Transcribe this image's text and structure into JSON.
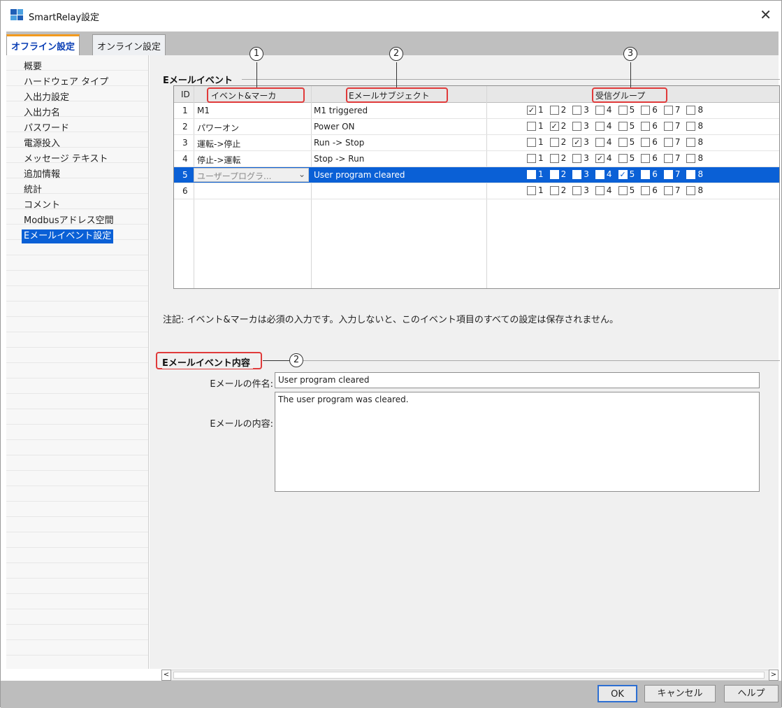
{
  "window": {
    "title": "SmartRelay設定",
    "close_glyph": "✕"
  },
  "tabs": [
    {
      "label": "オフライン設定"
    },
    {
      "label": "オンライン設定"
    }
  ],
  "sidebar": {
    "items": [
      {
        "label": "概要"
      },
      {
        "label": "ハードウェア タイプ"
      },
      {
        "label": "入出力設定"
      },
      {
        "label": "入出力名"
      },
      {
        "label": "パスワード"
      },
      {
        "label": "電源投入"
      },
      {
        "label": "メッセージ テキスト"
      },
      {
        "label": "追加情報"
      },
      {
        "label": "統計"
      },
      {
        "label": "コメント"
      },
      {
        "label": "Modbusアドレス空間"
      },
      {
        "label": "Eメールイベント設定"
      }
    ]
  },
  "email_events": {
    "section_title": "Eメールイベント",
    "columns": {
      "id": "ID",
      "event": "イベント&マーカ",
      "subject": "Eメールサブジェクト",
      "groups": "受信グループ"
    },
    "rows": [
      {
        "id": "1",
        "event": "M1",
        "subject": "M1 triggered",
        "groups": [
          true,
          false,
          false,
          false,
          false,
          false,
          false,
          false
        ]
      },
      {
        "id": "2",
        "event": "パワーオン",
        "subject": "Power ON",
        "groups": [
          false,
          true,
          false,
          false,
          false,
          false,
          false,
          false
        ]
      },
      {
        "id": "3",
        "event": "運転->停止",
        "subject": "Run -> Stop",
        "groups": [
          false,
          false,
          true,
          false,
          false,
          false,
          false,
          false
        ]
      },
      {
        "id": "4",
        "event": "停止->運転",
        "subject": "Stop -> Run",
        "groups": [
          false,
          false,
          false,
          true,
          false,
          false,
          false,
          false
        ]
      },
      {
        "id": "5",
        "event": "ユーザープログラ...",
        "subject": "User program cleared",
        "groups": [
          false,
          false,
          false,
          false,
          true,
          false,
          false,
          false
        ]
      },
      {
        "id": "6",
        "event": "",
        "subject": "",
        "groups": [
          false,
          false,
          false,
          false,
          false,
          false,
          false,
          false
        ]
      }
    ],
    "group_labels": [
      "1",
      "2",
      "3",
      "4",
      "5",
      "6",
      "7",
      "8"
    ],
    "selected_row": 5
  },
  "callouts": [
    "1",
    "2",
    "3",
    "2"
  ],
  "note": "注記: イベント&マーカは必須の入力です。入力しないと、このイベント項目のすべての設定は保存されません。",
  "event_detail": {
    "section_title": "Eメールイベント内容",
    "subject_label": "Eメールの件名:",
    "subject_value": "User program cleared",
    "body_label": "Eメールの内容:",
    "body_value": "The user program was cleared."
  },
  "buttons": {
    "ok": "OK",
    "cancel": "キャンセル",
    "help": "ヘルプ"
  },
  "scroll": {
    "left_arrow": "<",
    "right_arrow": ">"
  },
  "colors": {
    "selection": "#0a60d6",
    "active_tab_accent": "#f39a1d",
    "callout_box": "#e03a3a"
  }
}
